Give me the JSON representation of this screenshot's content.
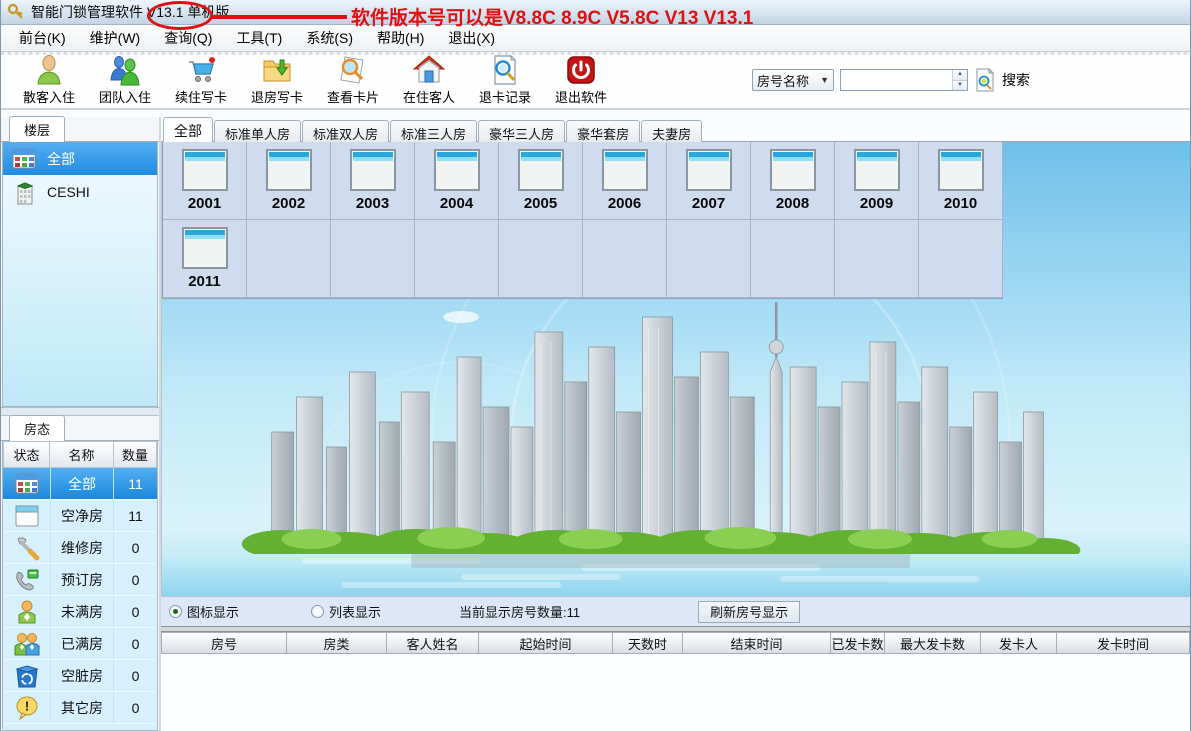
{
  "colors": {
    "accent_blue": "#2595e6",
    "selected_row_blue": "#2b96e8",
    "annotation_red": "#dd1111",
    "grid_cell_bg": "#cfdcef"
  },
  "title_bar": {
    "title": "智能门锁管理软件 V13.1 单机版",
    "annotation": "软件版本号可以是V8.8C 8.9C V5.8C V13 V13.1"
  },
  "menu": {
    "items": [
      "前台(K)",
      "维护(W)",
      "查询(Q)",
      "工具(T)",
      "系统(S)",
      "帮助(H)",
      "退出(X)"
    ]
  },
  "toolbar": {
    "buttons": [
      {
        "label": "散客入住",
        "icon": "person-icon"
      },
      {
        "label": "团队入住",
        "icon": "group-icon"
      },
      {
        "label": "续住写卡",
        "icon": "cart-icon"
      },
      {
        "label": "退房写卡",
        "icon": "folder-arrow-icon"
      },
      {
        "label": "查看卡片",
        "icon": "card-magnifier-icon"
      },
      {
        "label": "在住客人",
        "icon": "house-icon"
      },
      {
        "label": "退卡记录",
        "icon": "doc-magnifier-icon"
      },
      {
        "label": "退出软件",
        "icon": "power-icon"
      }
    ],
    "search": {
      "field_selector": "房号名称",
      "input_value": "",
      "button_label": "搜索"
    }
  },
  "sidebar": {
    "floors": {
      "tab_label": "楼层",
      "items": [
        {
          "label": "全部",
          "selected": true,
          "icon": "grid-icon"
        },
        {
          "label": "CESHI",
          "selected": false,
          "icon": "building-icon"
        }
      ]
    },
    "room_status": {
      "tab_label": "房态",
      "columns": [
        "状态",
        "名称",
        "数量"
      ],
      "rows": [
        {
          "name": "全部",
          "count": "11",
          "selected": true,
          "icon": "grid-icon"
        },
        {
          "name": "空净房",
          "count": "11",
          "selected": false,
          "icon": "window-icon"
        },
        {
          "name": "维修房",
          "count": "0",
          "selected": false,
          "icon": "wrench-icon"
        },
        {
          "name": "预订房",
          "count": "0",
          "selected": false,
          "icon": "phone-icon"
        },
        {
          "name": "未满房",
          "count": "0",
          "selected": false,
          "icon": "person-icon"
        },
        {
          "name": "已满房",
          "count": "0",
          "selected": false,
          "icon": "people-icon"
        },
        {
          "name": "空脏房",
          "count": "0",
          "selected": false,
          "icon": "recycle-bin-icon"
        },
        {
          "name": "其它房",
          "count": "0",
          "selected": false,
          "icon": "exclamation-icon"
        }
      ]
    }
  },
  "main": {
    "room_type_tabs": [
      {
        "label": "全部",
        "active": true
      },
      {
        "label": "标准单人房",
        "active": false
      },
      {
        "label": "标准双人房",
        "active": false
      },
      {
        "label": "标准三人房",
        "active": false
      },
      {
        "label": "豪华三人房",
        "active": false
      },
      {
        "label": "豪华套房",
        "active": false
      },
      {
        "label": "夫妻房",
        "active": false
      }
    ],
    "rooms": [
      "2001",
      "2002",
      "2003",
      "2004",
      "2005",
      "2006",
      "2007",
      "2008",
      "2009",
      "2010",
      "2011"
    ],
    "view_controls": {
      "icon_view_label": "图标显示",
      "list_view_label": "列表显示",
      "count_text": "当前显示房号数量:11",
      "refresh_button_label": "刷新房号显示"
    },
    "card_table": {
      "columns": [
        "房号",
        "房类",
        "客人姓名",
        "起始时间",
        "天数时",
        "结束时间",
        "已发卡数",
        "最大发卡数",
        "发卡人",
        "发卡时间"
      ]
    }
  }
}
